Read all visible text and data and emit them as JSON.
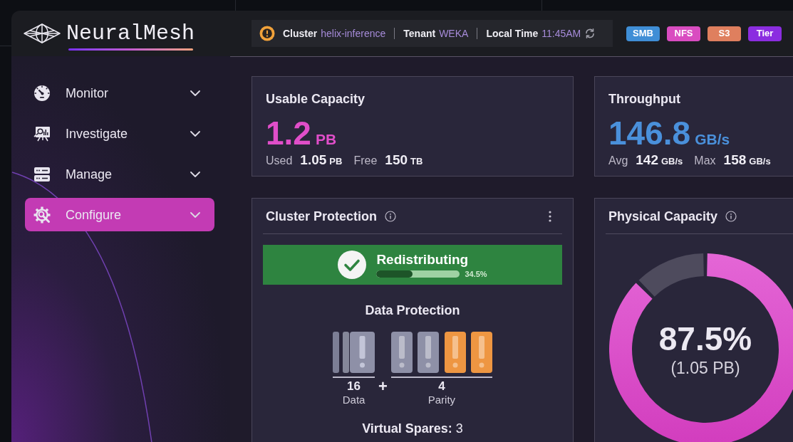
{
  "header": {
    "logo": "NeuralMesh",
    "context": [
      {
        "label": "Cluster",
        "value": "helix-inference"
      },
      {
        "label": "Tenant",
        "value": "WEKA"
      },
      {
        "label": "Local Time",
        "value": "11:45AM"
      }
    ],
    "protocols": [
      {
        "label": "SMB",
        "color": "#3f8ed6"
      },
      {
        "label": "NFS",
        "color": "#d94cc0"
      },
      {
        "label": "S3",
        "color": "#df7f5e"
      },
      {
        "label": "Tier",
        "color": "#8b2de0"
      }
    ]
  },
  "sidebar": {
    "items": [
      {
        "label": "Monitor",
        "selected": false,
        "expanded": false
      },
      {
        "label": "Investigate",
        "selected": false,
        "expanded": false
      },
      {
        "label": "Manage",
        "selected": false,
        "expanded": false
      },
      {
        "label": "Configure",
        "selected": true,
        "expanded": false
      }
    ]
  },
  "metrics": [
    {
      "title": "Usable Capacity",
      "value": "1.2",
      "unit": "PB",
      "color": "#e04ec9",
      "stats": [
        {
          "label": "Used",
          "value": "1.05",
          "unit": "PB"
        },
        {
          "label": "Free",
          "value": "150",
          "unit": "TB"
        }
      ]
    },
    {
      "title": "Throughput",
      "value": "146.8",
      "unit": "GB/s",
      "color": "#4a90db",
      "stats": [
        {
          "label": "Avg",
          "value": "142",
          "unit": "GB/s"
        },
        {
          "label": "Max",
          "value": "158",
          "unit": "GB/s"
        }
      ]
    }
  ],
  "cluster_protection": {
    "title": "Cluster Protection",
    "status": {
      "label": "Redistributing",
      "level": 0.43,
      "reading": "34.5%"
    },
    "data_protection": {
      "title": "Data Protection",
      "data": {
        "count": "16",
        "label": "Data"
      },
      "operator": "+",
      "parity": {
        "count": "4",
        "label": "Parity",
        "drives": [
          {
            "color": "#8e90a7"
          },
          {
            "color": "#8e90a7"
          },
          {
            "color": "#ee9642"
          },
          {
            "color": "#ee9642"
          }
        ]
      }
    },
    "virtual_spares": "**Virtual Spares:** 3"
  },
  "physical_capacity": {
    "title": "Physical Capacity",
    "chart_data": {
      "type": "donut",
      "values": [
        87.5,
        12.5
      ]
    },
    "percent": "87.5%",
    "amount": "(1.05 PB)"
  }
}
